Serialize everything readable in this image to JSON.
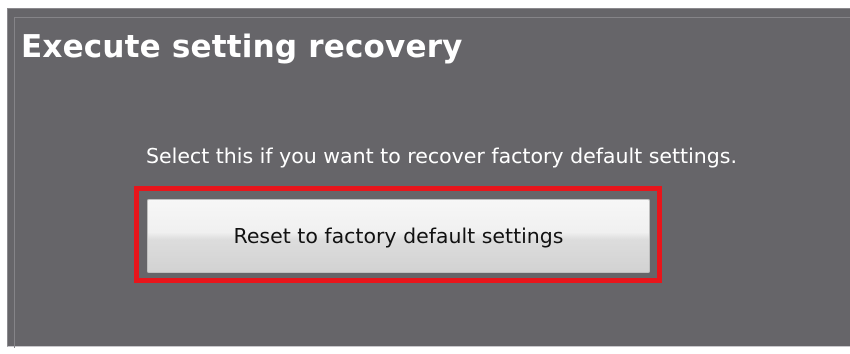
{
  "section": {
    "title": "Execute setting recovery",
    "description": "Select this if you want to recover factory default settings.",
    "reset_button_label": "Reset to factory default settings",
    "highlight_color": "#e8151b",
    "panel_color": "#666569"
  }
}
